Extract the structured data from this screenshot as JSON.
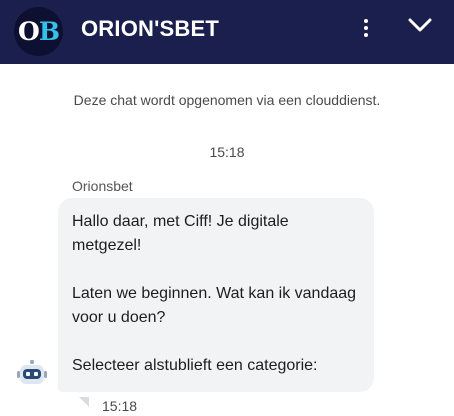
{
  "header": {
    "logo_text": "OB",
    "title": "ORION'SBET",
    "background_color": "#1b1f4d",
    "accent_color": "#36c0e8",
    "menu_icon": "more-vertical-icon",
    "collapse_icon": "chevron-down-icon"
  },
  "chat": {
    "notice": "Deze chat wordt opgenomen via een clouddienst.",
    "timestamp": "15:18",
    "sender": "Orionsbet",
    "message": {
      "paragraphs": [
        "Hallo daar, met Ciff! Je digitale metgezel!",
        "Laten we beginnen. Wat kan ik vandaag voor u doen?",
        "Selecteer alstublieft een categorie:"
      ],
      "time": "15:18",
      "bubble_color": "#f2f3f5"
    },
    "bot_avatar_icon": "robot-icon",
    "status_icon": "message-sent-icon"
  }
}
